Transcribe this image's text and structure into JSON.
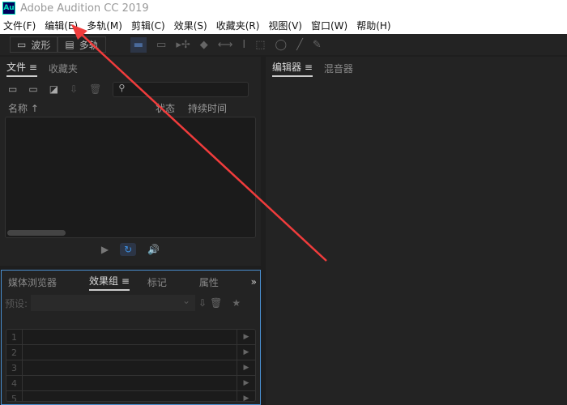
{
  "app": {
    "logo": "Au",
    "title": "Adobe Audition CC 2019"
  },
  "menu": [
    "文件(F)",
    "编辑(E)",
    "多轨(M)",
    "剪辑(C)",
    "效果(S)",
    "收藏夹(R)",
    "视图(V)",
    "窗口(W)",
    "帮助(H)"
  ],
  "toolbar": {
    "waveform": "波形",
    "multitrack": "多轨"
  },
  "files_panel": {
    "tabs": [
      "文件",
      "收藏夹"
    ],
    "columns": [
      "名称",
      "状态",
      "持续时间"
    ]
  },
  "editor_panel": {
    "tabs": [
      "编辑器",
      "混音器"
    ]
  },
  "effects_panel": {
    "tabs": [
      "媒体浏览器",
      "效果组",
      "标记",
      "属性"
    ],
    "preset_label": "预设:",
    "rows": [
      "1",
      "2",
      "3",
      "4",
      "5"
    ]
  },
  "annotation": {
    "color": "#f03c3c"
  }
}
